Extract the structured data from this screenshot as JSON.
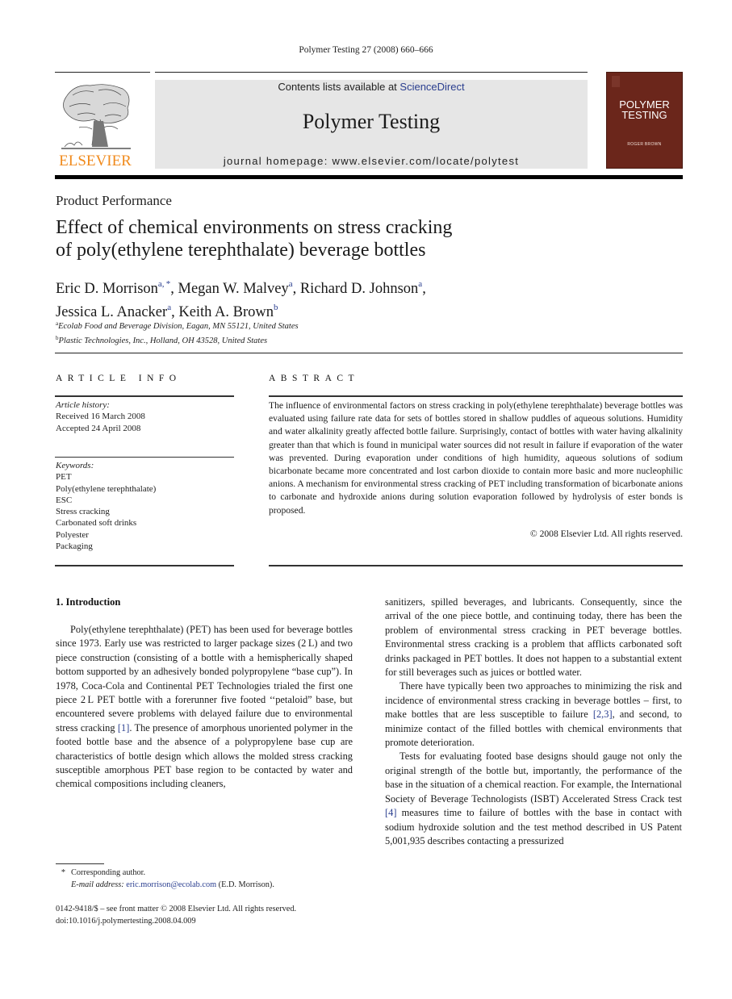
{
  "citation": "Polymer Testing 27 (2008) 660–666",
  "masthead": {
    "publisher": "ELSEVIER",
    "contents_prefix": "Contents lists available at ",
    "contents_link": "ScienceDirect",
    "journal_name": "Polymer Testing",
    "homepage": "journal homepage: www.elsevier.com/locate/polytest",
    "cover_title_line1": "POLYMER",
    "cover_title_line2": "TESTING",
    "cover_editor": "ROGER BROWN",
    "colors": {
      "publisher_orange": "#f08a1c",
      "cover_brown": "#6b261b",
      "link_blue": "#2a3e8f",
      "masthead_gray": "#e6e6e6"
    }
  },
  "article": {
    "section": "Product Performance",
    "title_line1": "Effect of chemical environments on stress cracking",
    "title_line2": "of poly(ethylene terephthalate) beverage bottles",
    "authors": [
      {
        "name": "Eric D. Morrison",
        "sup": "a, *",
        "sep": ", "
      },
      {
        "name": "Megan W. Malvey",
        "sup": "a",
        "sep": ", "
      },
      {
        "name": "Richard D. Johnson",
        "sup": "a",
        "sep": ","
      },
      {
        "name": "Jessica L. Anacker",
        "sup": "a",
        "sep": ", "
      },
      {
        "name": "Keith A. Brown",
        "sup": "b",
        "sep": ""
      }
    ],
    "affiliations": [
      {
        "mark": "a",
        "text": "Ecolab Food and Beverage Division, Eagan, MN 55121, United States"
      },
      {
        "mark": "b",
        "text": "Plastic Technologies, Inc., Holland, OH 43528, United States"
      }
    ]
  },
  "article_info": {
    "heading": "ARTICLE INFO",
    "history_label": "Article history:",
    "received": "Received 16 March 2008",
    "accepted": "Accepted 24 April 2008",
    "keywords_label": "Keywords:",
    "keywords": [
      "PET",
      "Poly(ethylene terephthalate)",
      "ESC",
      "Stress cracking",
      "Carbonated soft drinks",
      "Polyester",
      "Packaging"
    ]
  },
  "abstract": {
    "heading": "ABSTRACT",
    "text": "The influence of environmental factors on stress cracking in poly(ethylene terephthalate) beverage bottles was evaluated using failure rate data for sets of bottles stored in shallow puddles of aqueous solutions. Humidity and water alkalinity greatly affected bottle failure. Surprisingly, contact of bottles with water having alkalinity greater than that which is found in municipal water sources did not result in failure if evaporation of the water was prevented. During evaporation under conditions of high humidity, aqueous solutions of sodium bicarbonate became more concentrated and lost carbon dioxide to contain more basic and more nucleophilic anions. A mechanism for environmental stress cracking of PET including transformation of bicarbonate anions to carbonate and hydroxide anions during solution evaporation followed by hydrolysis of ester bonds is proposed.",
    "copyright": "© 2008 Elsevier Ltd. All rights reserved."
  },
  "intro": {
    "heading": "1.  Introduction",
    "left_p1_a": "Poly(ethylene terephthalate) (PET) has been used for beverage bottles since 1973. Early use was restricted to larger package sizes (2 L) and two piece construction (consisting of a bottle with a hemispherically shaped bottom supported by an adhesively bonded polypropylene “base cup”). In 1978, Coca-Cola and Continental PET Technologies trialed the first one piece 2 L PET bottle with a forerunner five footed ‘‘petaloid” base, but encoun­tered severe problems with delayed failure due to environ­mental stress cracking ",
    "left_ref1": "[1]",
    "left_p1_b": ". The presence of amorphous unoriented polymer in the footed bottle base and the absence of a polypropylene base cup are characteristics of bottle design which allows the molded stress cracking susceptible amorphous PET base region to be contacted by water and chemical compositions including cleaners,",
    "right_p1": "sanitizers, spilled beverages, and lubricants. Consequently, since the arrival of the one piece bottle, and continuing today, there has been the problem of environmental stress cracking in PET beverage bottles. Environmental stress cracking is a problem that afflicts carbonated soft drinks packaged in PET bottles. It does not happen to a substantial extent for still beverages such as juices or bottled water.",
    "right_p2_a": "There have typically been two approaches to minimiz­ing the risk and incidence of environmental stress cracking in beverage bottles – first, to make bottles that are less sus­ceptible to failure ",
    "right_ref2": "[2,3]",
    "right_p2_b": ", and second, to minimize contact of the filled bottles with chemical environments that promote deterioration.",
    "right_p3_a": "Tests for evaluating footed base designs should gauge not only the original strength of the bottle but, importantly, the performance of the base in the situation of a chemical reaction. For example, the International Society of Beverage Technologists (ISBT) Accelerated Stress Crack test ",
    "right_ref4": "[4]",
    "right_p3_b": " mea­sures time to failure of bottles with the base in contact with sodium hydroxide solution and the test method described in US Patent 5,001,935 describes contacting a pressurized"
  },
  "footnotes": {
    "star": "*",
    "corresponding": "Corresponding author.",
    "email_label": "E-mail address:",
    "email": "eric.morrison@ecolab.com",
    "email_suffix": " (E.D. Morrison).",
    "issn": "0142-9418/$ – see front matter © 2008 Elsevier Ltd. All rights reserved.",
    "doi": "doi:10.1016/j.polymertesting.2008.04.009"
  }
}
